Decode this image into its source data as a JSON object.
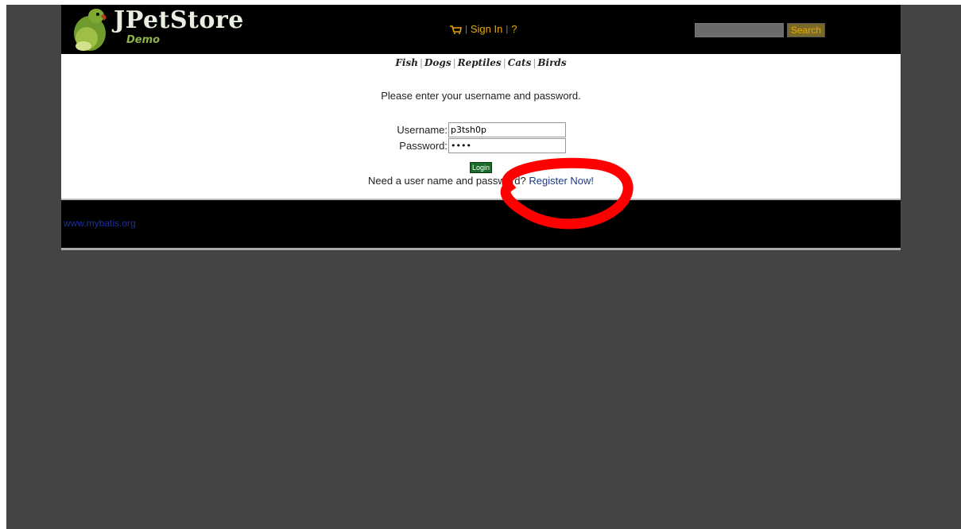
{
  "header": {
    "logo_title": "JPetStore",
    "logo_subtitle": "Demo",
    "menu": {
      "cart_icon": "cart-icon",
      "sign_in_label": "Sign In",
      "help_label": "?"
    },
    "search": {
      "input_value": "",
      "button_label": "Search"
    }
  },
  "quicklinks": [
    "Fish",
    "Dogs",
    "Reptiles",
    "Cats",
    "Birds"
  ],
  "login": {
    "message": "Please enter your username and password.",
    "username_label": "Username:",
    "username_value": "p3tsh0p",
    "password_label": "Password:",
    "password_value": "••••",
    "login_button": "Login",
    "register_prompt": "Need a user name and password?",
    "register_link": "Register Now!"
  },
  "footer": {
    "link": "www.mybatis.org"
  },
  "colors": {
    "header_bg": "#000000",
    "menu_text": "#e8a800",
    "viewport_bg": "#444444",
    "login_button": "#1b6b2b",
    "annotation": "#ff0000"
  }
}
